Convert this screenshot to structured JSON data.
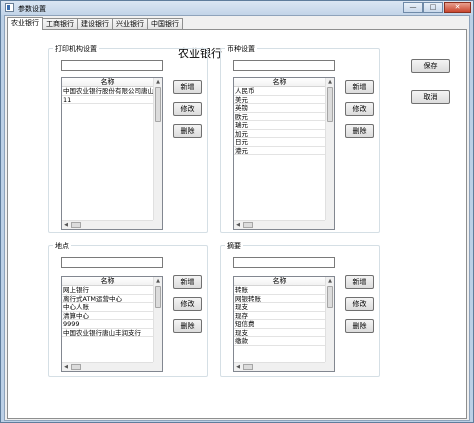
{
  "window": {
    "title": "参数设置",
    "icon": "app-icon",
    "controls": [
      "minimize",
      "maximize",
      "close"
    ],
    "control_glyphs": {
      "minimize": "—",
      "maximize": "□",
      "close": "✕"
    }
  },
  "tabs": [
    {
      "label": "农业银行",
      "active": true
    },
    {
      "label": "工商银行",
      "active": false
    },
    {
      "label": "建设银行",
      "active": false
    },
    {
      "label": "兴业银行",
      "active": false
    },
    {
      "label": "中国银行",
      "active": false
    }
  ],
  "bank_title": "农业银行",
  "actions": {
    "save": "保存",
    "cancel": "取消"
  },
  "sections": {
    "printer": {
      "label": "打印机构设置",
      "input_value": "",
      "column": "名称",
      "rows": [
        "中国农业银行股份有限公司唐山",
        "11"
      ],
      "buttons": {
        "add": "新增",
        "edit": "修改",
        "delete": "删除"
      }
    },
    "currency": {
      "label": "币种设置",
      "input_value": "",
      "column": "名称",
      "rows": [
        "人民币",
        "美元",
        "英镑",
        "欧元",
        "瑞元",
        "加元",
        "日元",
        "港元"
      ],
      "buttons": {
        "add": "新增",
        "edit": "修改",
        "delete": "删除"
      }
    },
    "location": {
      "label": "地点",
      "input_value": "",
      "column": "名称",
      "rows": [
        "网上银行",
        "离行式ATM运营中心",
        "中心人账",
        "清算中心",
        "9999",
        "中国农业银行唐山丰润支行"
      ],
      "buttons": {
        "add": "新增",
        "edit": "修改",
        "delete": "删除"
      }
    },
    "summary": {
      "label": "摘要",
      "input_value": "",
      "column": "名称",
      "rows": [
        "转账",
        "网银转账",
        "现支",
        "现存",
        "短信费",
        "现支",
        "缴款"
      ],
      "buttons": {
        "add": "新增",
        "edit": "修改",
        "delete": "删除"
      }
    }
  }
}
